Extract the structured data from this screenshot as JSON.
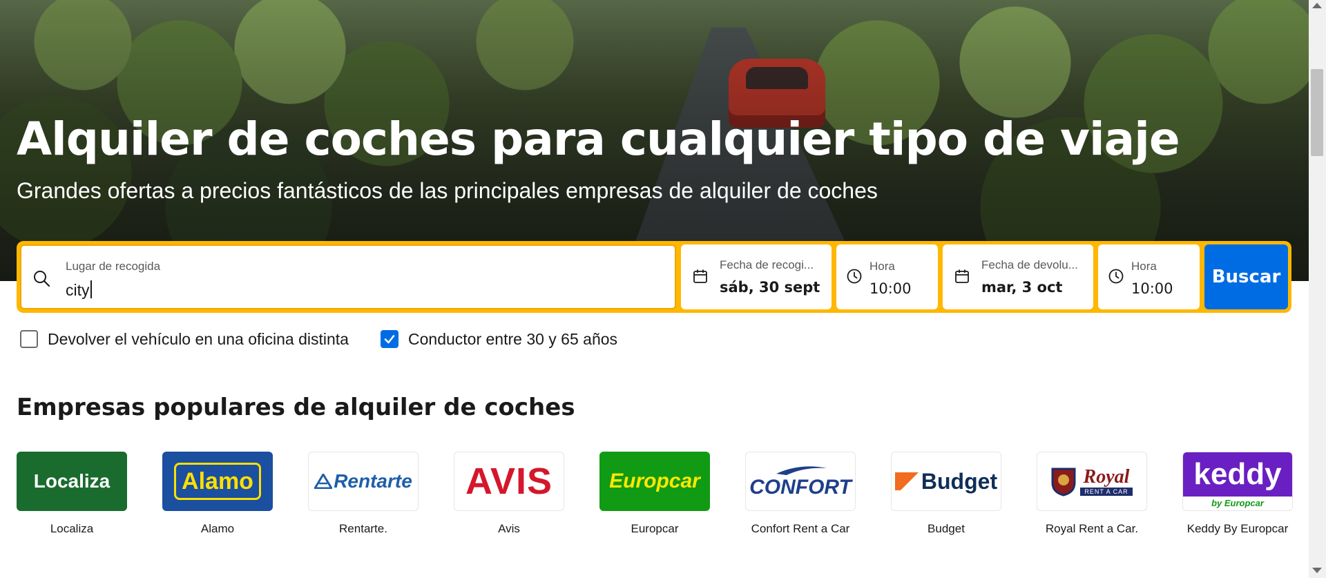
{
  "hero": {
    "title": "Alquiler de coches para cualquier tipo de viaje",
    "subtitle": "Grandes ofertas a precios fantásticos de las principales empresas de alquiler de coches"
  },
  "search": {
    "location": {
      "label": "Lugar de recogida",
      "value": "city",
      "icon": "search-icon"
    },
    "pickup_date": {
      "label": "Fecha de recogi...",
      "value": "sáb, 30 sept",
      "icon": "calendar-icon"
    },
    "pickup_time": {
      "label": "Hora",
      "value": "10:00",
      "icon": "clock-icon"
    },
    "return_date": {
      "label": "Fecha de devolu...",
      "value": "mar, 3 oct",
      "icon": "calendar-icon"
    },
    "return_time": {
      "label": "Hora",
      "value": "10:00",
      "icon": "clock-icon"
    },
    "button_label": "Buscar"
  },
  "options": {
    "different_office": {
      "label": "Devolver el vehículo en una oficina distinta",
      "checked": false
    },
    "driver_age": {
      "label": "Conductor entre 30 y 65 años",
      "checked": true
    }
  },
  "popular": {
    "title": "Empresas populares de alquiler de coches",
    "companies": [
      {
        "name": "Localiza",
        "logo_text": "Localiza",
        "bg": "#1a6b2e",
        "fg": "#ffffff"
      },
      {
        "name": "Alamo",
        "logo_text": "Alamo",
        "bg": "#1b4fa0",
        "fg": "#ffe000"
      },
      {
        "name": "Rentarte.",
        "logo_text": "Rentarte",
        "bg": "#ffffff",
        "fg": "#1d5fa8"
      },
      {
        "name": "Avis",
        "logo_text": "AVIS",
        "bg": "#ffffff",
        "fg": "#d4172b"
      },
      {
        "name": "Europcar",
        "logo_text": "Europcar",
        "bg": "#119a14",
        "fg": "#ffe800"
      },
      {
        "name": "Confort Rent a Car",
        "logo_text": "CONFORT",
        "bg": "#ffffff",
        "fg": "#1e3f8a"
      },
      {
        "name": "Budget",
        "logo_text": "Budget",
        "bg": "#ffffff",
        "fg": "#0f2e58"
      },
      {
        "name": "Royal Rent a Car.",
        "logo_text": "Royal",
        "logo_sub": "RENT A CAR",
        "bg": "#ffffff",
        "fg": "#8a1b1b"
      },
      {
        "name": "Keddy By Europcar",
        "logo_text": "keddy",
        "logo_sub": "by Europcar",
        "bg": "#6a1fc2",
        "fg": "#ffffff"
      }
    ]
  },
  "colors": {
    "accent_yellow": "#ffb700",
    "primary_blue": "#006ce4"
  }
}
